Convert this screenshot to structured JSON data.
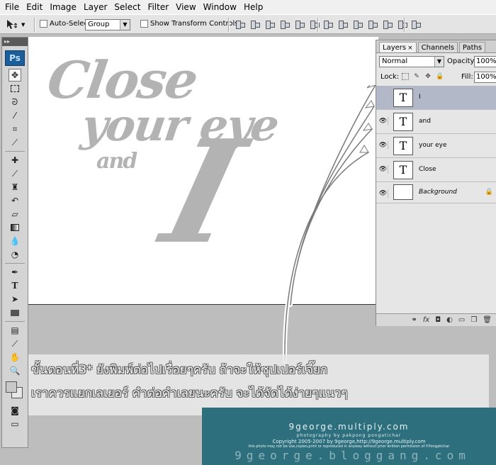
{
  "menubar": {
    "items": [
      "File",
      "Edit",
      "Image",
      "Layer",
      "Select",
      "Filter",
      "View",
      "Window",
      "Help"
    ]
  },
  "optionsbar": {
    "auto_select_label": "Auto-Select:",
    "auto_select_value": "Group",
    "show_transform_label": "Show Transform Controls"
  },
  "tools": {
    "logo": "Ps",
    "grip": "▸▸"
  },
  "canvas": {
    "line1": "Close",
    "line2": "your eye",
    "line3": "and",
    "line4": "I"
  },
  "layers_panel": {
    "tabs": [
      "Layers",
      "Channels",
      "Paths"
    ],
    "blend_mode": "Normal",
    "opacity_label": "Opacity:",
    "opacity_value": "100%",
    "lock_label": "Lock:",
    "fill_label": "Fill:",
    "fill_value": "100%",
    "layers": [
      {
        "thumb": "T",
        "name": "I",
        "selected": true,
        "visible": false
      },
      {
        "thumb": "T",
        "name": "and",
        "selected": false,
        "visible": true
      },
      {
        "thumb": "T",
        "name": "your eye",
        "selected": false,
        "visible": true
      },
      {
        "thumb": "T",
        "name": "Close",
        "selected": false,
        "visible": true
      },
      {
        "thumb": "",
        "name": "Background",
        "selected": false,
        "visible": true,
        "locked": true
      }
    ],
    "footer_icons": [
      "link-icon",
      "fx-icon",
      "mask-icon",
      "adjustment-icon",
      "folder-icon",
      "new-layer-icon",
      "trash-icon"
    ]
  },
  "caption": {
    "line1": "ขั้นตอนที่3* ยังพิมพ์ต่อไปเรื่อยๆครับ ถ้าจะให้ซุปเปอร์เจี๊ยก",
    "line2": "เราควรแยกเลเยอร์ คำต่อคำเลยนะครับ จะได้จัดได้ง่ายๆแนวๆ"
  },
  "watermark": {
    "title": "9george.multiply.com",
    "photo": "photography by pakpong pongatichar",
    "copyright": "Copyright 2005-2007 by 9george,http://9george.multiply.com",
    "legal": "this photo may not be use,copies,print or reproduced in anyway without prior written permission of P.Pongatichar",
    "blog": "9george.bloggang.com"
  },
  "colors": {
    "watermark_bg": "#2e6f7d",
    "selected_layer": "#b2b8c8",
    "canvas_text": "#b3b3b3"
  }
}
